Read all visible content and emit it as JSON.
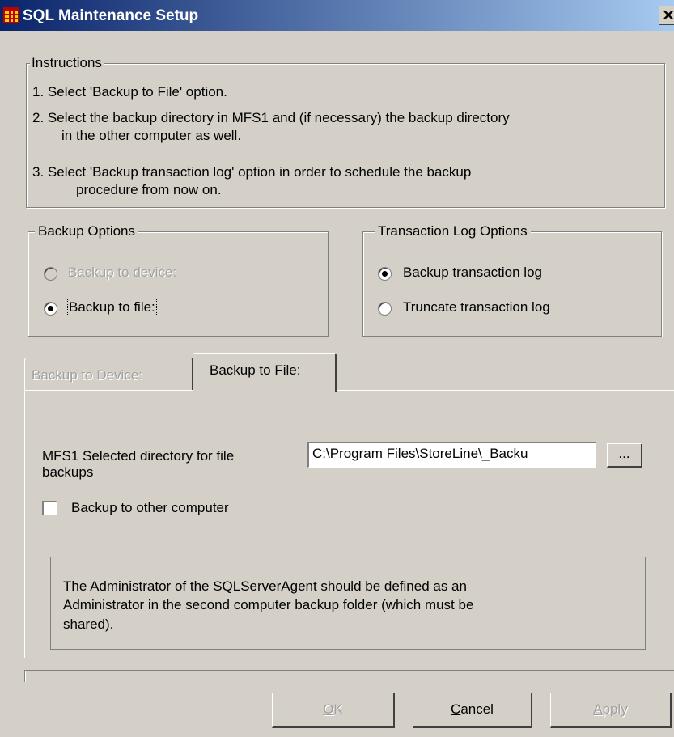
{
  "window": {
    "title": "SQL Maintenance Setup",
    "close_glyph": "✕",
    "icon": "database-app-icon"
  },
  "instructions": {
    "legend": "Instructions",
    "lines": [
      "1. Select 'Backup to File' option.",
      "2. Select the backup directory in MFS1 and (if necessary) the backup directory",
      "in the other computer as well.",
      "3. Select 'Backup transaction log' option in order to schedule the backup",
      "procedure from now on."
    ]
  },
  "backup_options": {
    "legend": "Backup Options",
    "device_label": "Backup to device:",
    "device_enabled": false,
    "file_label": "Backup to file:",
    "selected": "file"
  },
  "transaction_log_options": {
    "legend": "Transaction Log Options",
    "backup_label": "Backup transaction log",
    "truncate_label": "Truncate transaction log",
    "selected": "backup"
  },
  "tabs": [
    {
      "label": "Backup to Device:",
      "enabled": false,
      "active": false
    },
    {
      "label": "Backup to File:",
      "enabled": true,
      "active": true
    }
  ],
  "file_tab": {
    "dir_label_line1": "MFS1 Selected directory for file",
    "dir_label_line2": "backups",
    "dir_value": "C:\\Program Files\\StoreLine\\_Backu",
    "browse_label": "...",
    "other_computer_label": "Backup to other computer",
    "other_computer_checked": false,
    "note_lines": [
      "The Administrator of the SQLServerAgent should be defined as an",
      "Administrator in the second computer backup folder (which must be",
      "shared)."
    ]
  },
  "buttons": {
    "ok": {
      "mnemonic": "O",
      "rest": "K",
      "enabled": false
    },
    "cancel": {
      "mnemonic": "C",
      "rest": "ancel",
      "enabled": true
    },
    "apply": {
      "mnemonic": "A",
      "rest": "pply",
      "enabled": false
    }
  }
}
